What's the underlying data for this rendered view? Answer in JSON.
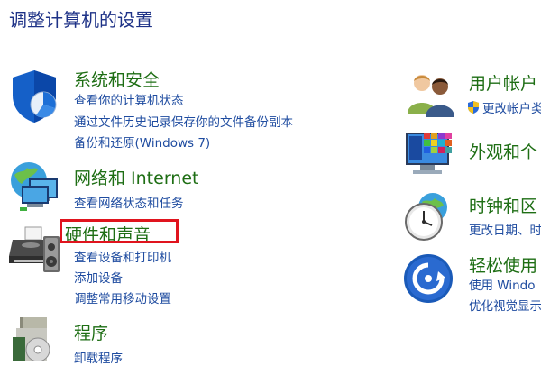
{
  "page_title": "调整计算机的设置",
  "left_column": {
    "system": {
      "title": "系统和安全",
      "links": [
        "查看你的计算机状态",
        "通过文件历史记录保存你的文件备份副本",
        "备份和还原(Windows 7)"
      ]
    },
    "network": {
      "title": "网络和 Internet",
      "links": [
        "查看网络状态和任务"
      ]
    },
    "hardware": {
      "title": "硬件和声音",
      "links": [
        "查看设备和打印机",
        "添加设备",
        "调整常用移动设置"
      ]
    },
    "programs": {
      "title": "程序",
      "links": [
        "卸载程序"
      ]
    }
  },
  "right_column": {
    "users": {
      "title": "用户帐户",
      "links": [
        "更改帐户类"
      ]
    },
    "appearance": {
      "title": "外观和个"
    },
    "clock": {
      "title": "时钟和区",
      "links": [
        "更改日期、时"
      ]
    },
    "access": {
      "title": "轻松使用",
      "links": [
        "使用 Windo",
        "优化视觉显示"
      ]
    }
  },
  "highlight_color": "#e0141e",
  "link_color": "#1f4ca0",
  "title_color": "#1e6e14"
}
